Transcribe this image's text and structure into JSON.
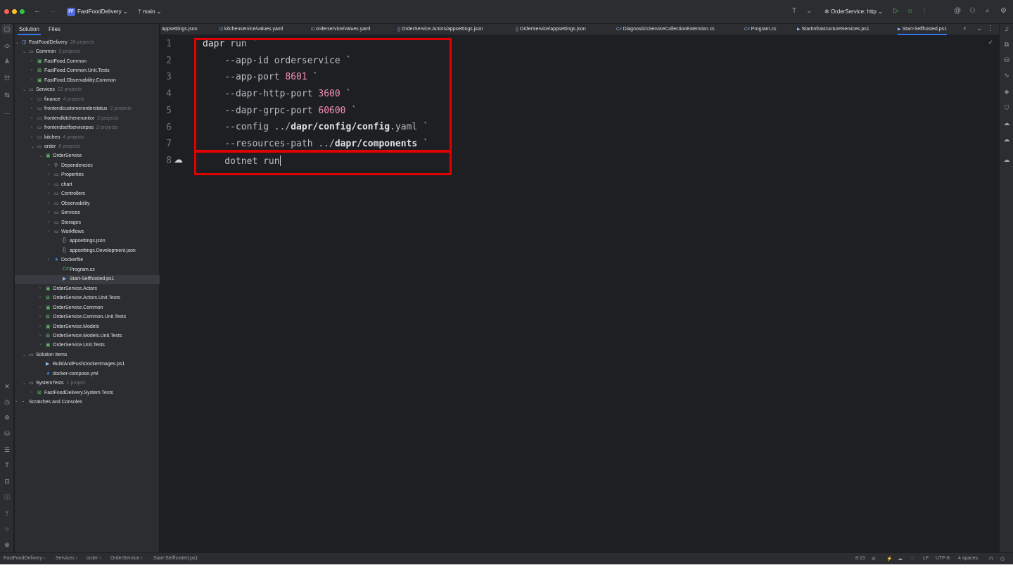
{
  "titlebar": {
    "project_badge": "FF",
    "project_name": "FastFoodDelivery",
    "branch": "main",
    "run_config": "OrderService: http"
  },
  "panel_tabs": [
    "Solution",
    "Files"
  ],
  "tree": [
    {
      "label": "FastFoodDelivery",
      "sub": "26 projects",
      "icon": "solution-icon"
    },
    {
      "label": "Common",
      "sub": "3 projects",
      "icon": "folder-icon"
    },
    {
      "label": "FastFood.Common",
      "sub": "",
      "icon": "project-icon"
    },
    {
      "label": "FastFood.Common.Unit.Tests",
      "sub": "",
      "icon": "test-project-icon"
    },
    {
      "label": "FastFood.Observability.Common",
      "sub": "",
      "icon": "project-icon"
    },
    {
      "label": "Services",
      "sub": "22 projects",
      "icon": "folder-icon"
    },
    {
      "label": "finance",
      "sub": "4 projects",
      "icon": "folder-icon"
    },
    {
      "label": "frontendcustomerorderstatus",
      "sub": "2 projects",
      "icon": "folder-icon"
    },
    {
      "label": "frontendkitchenmonitor",
      "sub": "2 projects",
      "icon": "folder-icon"
    },
    {
      "label": "frontendselfservicepos",
      "sub": "2 projects",
      "icon": "folder-icon"
    },
    {
      "label": "kitchen",
      "sub": "4 projects",
      "icon": "folder-icon"
    },
    {
      "label": "order",
      "sub": "8 projects",
      "icon": "folder-icon"
    },
    {
      "label": "OrderService",
      "sub": "",
      "icon": "project-icon"
    },
    {
      "label": "Dependencies",
      "sub": "",
      "icon": "dependencies-icon"
    },
    {
      "label": "Properties",
      "sub": "",
      "icon": "folder-icon"
    },
    {
      "label": "chart",
      "sub": "",
      "icon": "folder-icon"
    },
    {
      "label": "Controllers",
      "sub": "",
      "icon": "folder-icon"
    },
    {
      "label": "Observability",
      "sub": "",
      "icon": "folder-icon"
    },
    {
      "label": "Services",
      "sub": "",
      "icon": "folder-icon"
    },
    {
      "label": "Storages",
      "sub": "",
      "icon": "folder-icon"
    },
    {
      "label": "Workflows",
      "sub": "",
      "icon": "folder-icon"
    },
    {
      "label": "appsettings.json",
      "sub": "",
      "icon": "json-icon"
    },
    {
      "label": "appsettings.Development.json",
      "sub": "",
      "icon": "json-icon"
    },
    {
      "label": "Dockerfile",
      "sub": "",
      "icon": "docker-icon"
    },
    {
      "label": "Program.cs",
      "sub": "",
      "icon": "csharp-icon"
    },
    {
      "label": "Start-Selfhosted.ps1",
      "sub": "",
      "icon": "powershell-icon"
    },
    {
      "label": "OrderService.Actors",
      "sub": "",
      "icon": "project-icon"
    },
    {
      "label": "OrderService.Actors.Unit.Tests",
      "sub": "",
      "icon": "test-project-icon"
    },
    {
      "label": "OrderService.Common",
      "sub": "",
      "icon": "project-icon"
    },
    {
      "label": "OrderService.Common.Unit.Tests",
      "sub": "",
      "icon": "test-project-icon"
    },
    {
      "label": "OrderService.Models",
      "sub": "",
      "icon": "project-icon"
    },
    {
      "label": "OrderService.Models.Unit.Tests",
      "sub": "",
      "icon": "test-project-icon"
    },
    {
      "label": "OrderService.Unit.Tests",
      "sub": "",
      "icon": "project-icon"
    },
    {
      "label": "Solution Items",
      "sub": "",
      "icon": "folder-icon"
    },
    {
      "label": "BuildAndPushDockerImages.ps1",
      "sub": "",
      "icon": "powershell-icon"
    },
    {
      "label": "docker-compose.yml",
      "sub": "",
      "icon": "docker-icon"
    },
    {
      "label": "SystemTests",
      "sub": "1 project",
      "icon": "folder-icon"
    },
    {
      "label": "FastFoodDelivery.System.Tests",
      "sub": "",
      "icon": "test-project-icon"
    },
    {
      "label": "Scratches and Consoles",
      "sub": "",
      "icon": "scratches-icon"
    }
  ],
  "editor_tabs": [
    {
      "label": "appsettings.json",
      "icon": "json-icon"
    },
    {
      "label": "kitchenservice/values.yaml",
      "icon": "yaml-icon"
    },
    {
      "label": "orderservice/values.yaml",
      "icon": "yaml-icon"
    },
    {
      "label": "OrderService.Actors/appsettings.json",
      "icon": "json-icon"
    },
    {
      "label": "OrderService/appsettings.json",
      "icon": "json-icon"
    },
    {
      "label": "DiagnosticsServiceCollectionExtension.cs",
      "icon": "csharp-icon"
    },
    {
      "label": "Program.cs",
      "icon": "csharp-icon"
    },
    {
      "label": "StartInfrastructureServices.ps1",
      "icon": "powershell-icon"
    },
    {
      "label": "Start-Selfhosted.ps1",
      "icon": "powershell-icon"
    }
  ],
  "code": {
    "line_numbers": [
      "1",
      "2",
      "3",
      "4",
      "5",
      "6",
      "7",
      "8"
    ],
    "l1_kw": "dapr",
    "l1_rest": " run `",
    "l2": "    --app-id orderservice `",
    "l3_a": "    --app-port ",
    "l3_num": "8601",
    "l3_b": " `",
    "l4_a": "    --dapr-http-port ",
    "l4_num": "3600",
    "l4_b": " `",
    "l5_a": "    --dapr-grpc-port ",
    "l5_num": "60600",
    "l5_b": " `",
    "l6_a": "    --config ../",
    "l6_path": "dapr/config/config",
    "l6_b": ".yaml `",
    "l7_a": "    --resources-path ../",
    "l7_path": "dapr/components",
    "l7_b": " `",
    "l8": "    dotnet run"
  },
  "statusbar": {
    "breadcrumb": [
      "FastFoodDelivery",
      "Services",
      "order",
      "OrderService",
      "Start-Selfhosted.ps1"
    ],
    "position": "8:15",
    "line_ending": "LF",
    "encoding": "UTF-8",
    "indent": "4 spaces"
  },
  "colors": {
    "accent": "#3574f0",
    "highlight_box": "#e00000",
    "number": "#f58fb6"
  }
}
